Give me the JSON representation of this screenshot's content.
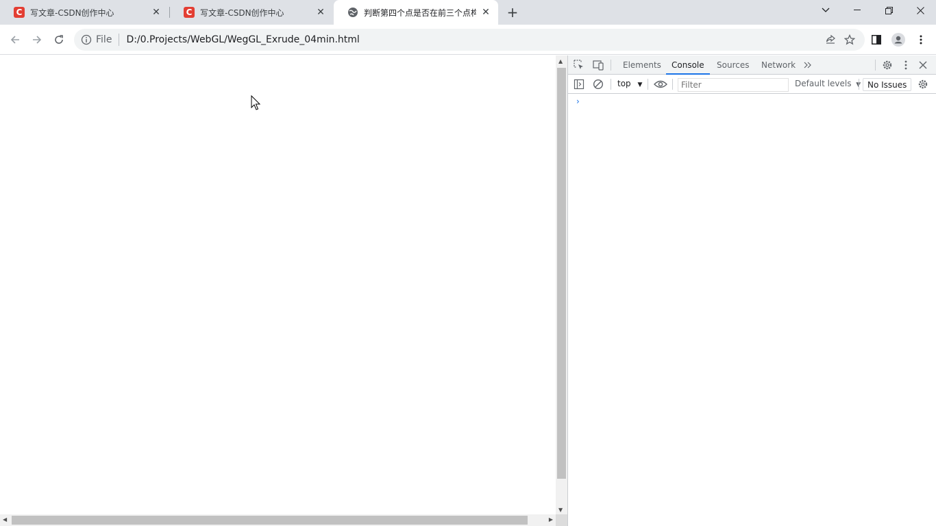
{
  "tabs": [
    {
      "title": "写文章-CSDN创作中心",
      "favicon": "C",
      "state": "inactive"
    },
    {
      "title": "写文章-CSDN创作中心",
      "favicon": "C",
      "state": "inactive"
    },
    {
      "title": "判断第四个点是否在前三个点构成",
      "favicon": "globe-icon",
      "state": "active"
    }
  ],
  "address_bar": {
    "scheme_label": "File",
    "url": "D:/0.Projects/WebGL/WegGL_Exrude_04min.html"
  },
  "devtools": {
    "tabs": [
      "Elements",
      "Console",
      "Sources",
      "Network"
    ],
    "selected_tab": "Console",
    "console": {
      "context": "top",
      "filter_placeholder": "Filter",
      "levels": "Default levels",
      "issues": "No Issues",
      "prompt_symbol": "›"
    }
  },
  "colors": {
    "tabstrip": "#dee1e6",
    "csdn_red": "#e33e33",
    "accent": "#1a73e8"
  }
}
